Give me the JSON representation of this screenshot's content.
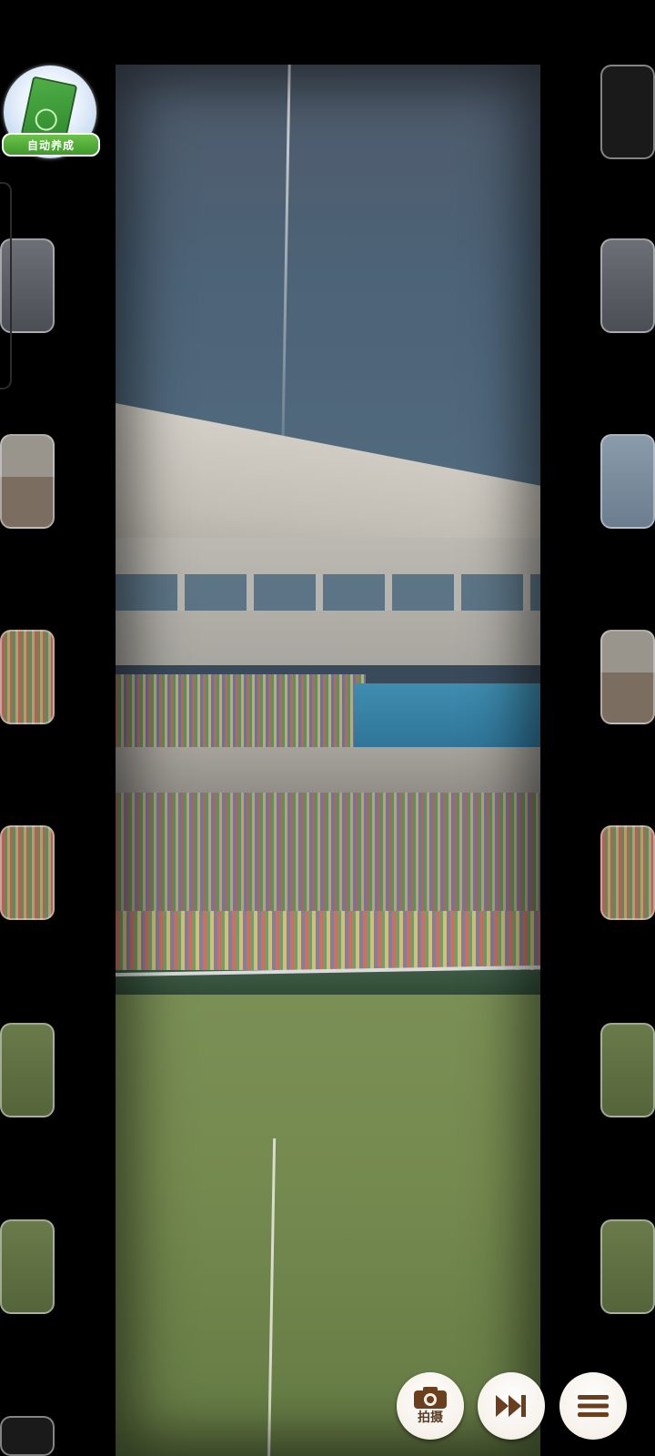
{
  "app": {
    "auto_train_badge": {
      "label": "自动养成",
      "icon": "training-book-icon"
    }
  },
  "controls": {
    "camera": {
      "label": "拍摄",
      "icon": "camera-icon"
    },
    "skip": {
      "icon": "fast-forward-icon"
    },
    "menu": {
      "icon": "hamburger-menu-icon"
    }
  },
  "colors": {
    "button_icon": "#6b3f1e",
    "badge_green": "#4fae45",
    "frame_border": "#dcdcdc"
  }
}
